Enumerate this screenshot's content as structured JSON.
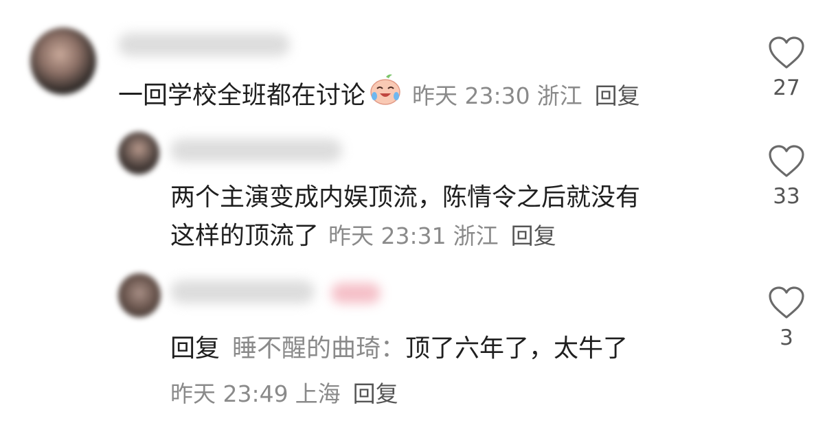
{
  "comments": [
    {
      "text": "一回学校全班都在讨论",
      "emoji": "crying-laughing-peach-emoji",
      "time": "昨天 23:30",
      "location": "浙江",
      "reply_label": "回复",
      "likes": "27"
    },
    {
      "text_line1": "两个主演变成内娱顶流，陈情令之后就没有",
      "text_line2": "这样的顶流了",
      "time": "昨天 23:31",
      "location": "浙江",
      "reply_label": "回复",
      "likes": "33"
    },
    {
      "reply_prefix": "回复",
      "reply_to": "睡不醒的曲琦：",
      "text": "顶了六年了，太牛了",
      "time": "昨天 23:49",
      "location": "上海",
      "reply_label": "回复",
      "likes": "3"
    }
  ],
  "icons": {
    "like": "heart-outline-icon"
  },
  "colors": {
    "meta": "#8a8a8a",
    "text": "#1f1f1f",
    "tag": "#f4b9c2"
  }
}
